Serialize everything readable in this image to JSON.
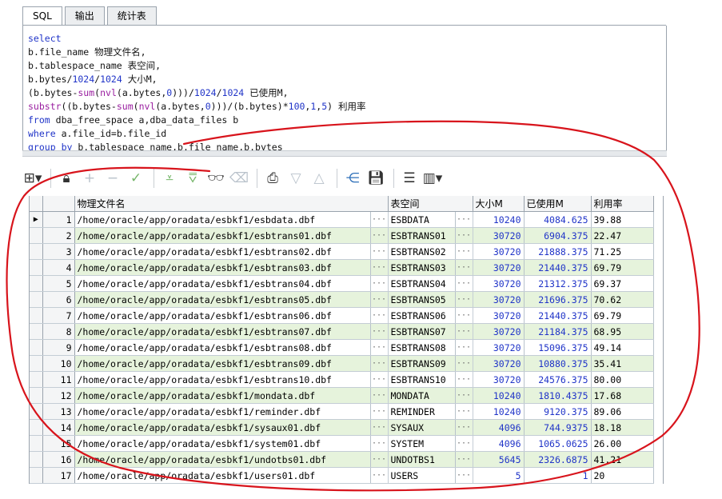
{
  "tabs": [
    {
      "label": "SQL",
      "active": true
    },
    {
      "label": "输出",
      "active": false
    },
    {
      "label": "统计表",
      "active": false
    }
  ],
  "sql": {
    "lines": [
      "select",
      "b.file_name 物理文件名,",
      "b.tablespace_name 表空间,",
      "b.bytes/1024/1024 大小M,",
      "(b.bytes-sum(nvl(a.bytes,0)))/1024/1024 已使用M,",
      "substr((b.bytes-sum(nvl(a.bytes,0)))/(b.bytes)*100,1,5) 利用率",
      "from dba_free_space a,dba_data_files b",
      "where a.file_id=b.file_id",
      "group by b.tablespace_name,b.file_name,b.bytes"
    ]
  },
  "toolbar": {
    "icons": [
      "grid-icon",
      "lock-icon",
      "plus-icon",
      "minus-icon",
      "check-icon",
      "filter-down-icon",
      "filter-all-icon",
      "binoculars-icon",
      "eraser-icon",
      "print-icon",
      "triangle-down-icon",
      "triangle-up-icon",
      "tree-icon",
      "save-icon",
      "sql-icon",
      "chart-icon"
    ]
  },
  "grid": {
    "columns": [
      "物理文件名",
      "表空间",
      "大小M",
      "已使用M",
      "利用率"
    ],
    "rows": [
      {
        "n": "1",
        "file": "/home/oracle/app/oradata/esbkf1/esbdata.dbf",
        "ts": "ESBDATA",
        "size": "10240",
        "used": "4084.625",
        "rate": "39.88"
      },
      {
        "n": "2",
        "file": "/home/oracle/app/oradata/esbkf1/esbtrans01.dbf",
        "ts": "ESBTRANS01",
        "size": "30720",
        "used": "6904.375",
        "rate": "22.47"
      },
      {
        "n": "3",
        "file": "/home/oracle/app/oradata/esbkf1/esbtrans02.dbf",
        "ts": "ESBTRANS02",
        "size": "30720",
        "used": "21888.375",
        "rate": "71.25"
      },
      {
        "n": "4",
        "file": "/home/oracle/app/oradata/esbkf1/esbtrans03.dbf",
        "ts": "ESBTRANS03",
        "size": "30720",
        "used": "21440.375",
        "rate": "69.79"
      },
      {
        "n": "5",
        "file": "/home/oracle/app/oradata/esbkf1/esbtrans04.dbf",
        "ts": "ESBTRANS04",
        "size": "30720",
        "used": "21312.375",
        "rate": "69.37"
      },
      {
        "n": "6",
        "file": "/home/oracle/app/oradata/esbkf1/esbtrans05.dbf",
        "ts": "ESBTRANS05",
        "size": "30720",
        "used": "21696.375",
        "rate": "70.62"
      },
      {
        "n": "7",
        "file": "/home/oracle/app/oradata/esbkf1/esbtrans06.dbf",
        "ts": "ESBTRANS06",
        "size": "30720",
        "used": "21440.375",
        "rate": "69.79"
      },
      {
        "n": "8",
        "file": "/home/oracle/app/oradata/esbkf1/esbtrans07.dbf",
        "ts": "ESBTRANS07",
        "size": "30720",
        "used": "21184.375",
        "rate": "68.95"
      },
      {
        "n": "9",
        "file": "/home/oracle/app/oradata/esbkf1/esbtrans08.dbf",
        "ts": "ESBTRANS08",
        "size": "30720",
        "used": "15096.375",
        "rate": "49.14"
      },
      {
        "n": "10",
        "file": "/home/oracle/app/oradata/esbkf1/esbtrans09.dbf",
        "ts": "ESBTRANS09",
        "size": "30720",
        "used": "10880.375",
        "rate": "35.41"
      },
      {
        "n": "11",
        "file": "/home/oracle/app/oradata/esbkf1/esbtrans10.dbf",
        "ts": "ESBTRANS10",
        "size": "30720",
        "used": "24576.375",
        "rate": "80.00"
      },
      {
        "n": "12",
        "file": "/home/oracle/app/oradata/esbkf1/mondata.dbf",
        "ts": "MONDATA",
        "size": "10240",
        "used": "1810.4375",
        "rate": "17.68"
      },
      {
        "n": "13",
        "file": "/home/oracle/app/oradata/esbkf1/reminder.dbf",
        "ts": "REMINDER",
        "size": "10240",
        "used": "9120.375",
        "rate": "89.06"
      },
      {
        "n": "14",
        "file": "/home/oracle/app/oradata/esbkf1/sysaux01.dbf",
        "ts": "SYSAUX",
        "size": "4096",
        "used": "744.9375",
        "rate": "18.18"
      },
      {
        "n": "15",
        "file": "/home/oracle/app/oradata/esbkf1/system01.dbf",
        "ts": "SYSTEM",
        "size": "4096",
        "used": "1065.0625",
        "rate": "26.00"
      },
      {
        "n": "16",
        "file": "/home/oracle/app/oradata/esbkf1/undotbs01.dbf",
        "ts": "UNDOTBS1",
        "size": "5645",
        "used": "2326.6875",
        "rate": "41.21"
      },
      {
        "n": "17",
        "file": "/home/oracle/app/oradata/esbkf1/users01.dbf",
        "ts": "USERS",
        "size": "5",
        "used": "1",
        "rate": "20"
      }
    ],
    "ellipsis": "···",
    "current_row_marker": "▶"
  },
  "colors": {
    "even_row": "#e6f3dc",
    "keyword": "#2034c8",
    "function": "#9a1fa0",
    "annotation": "#d8141c"
  }
}
